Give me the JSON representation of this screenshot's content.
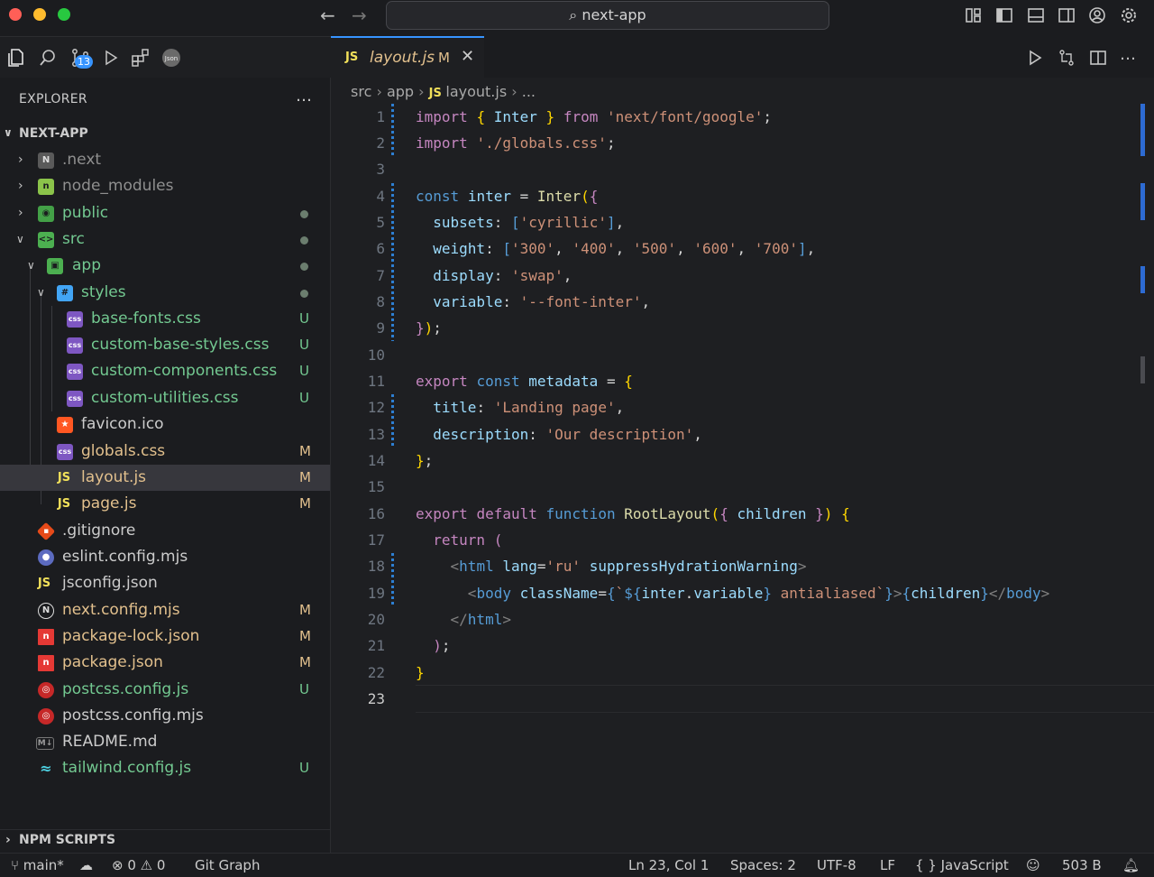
{
  "window": {
    "search_text": "next-app"
  },
  "activity": {
    "badge": "13"
  },
  "sidebar": {
    "title": "EXPLORER",
    "root": "NEXT-APP",
    "npm": "NPM SCRIPTS",
    "items": [
      {
        "name": ".next",
        "status": ""
      },
      {
        "name": "node_modules",
        "status": ""
      },
      {
        "name": "public",
        "status": ""
      },
      {
        "name": "src",
        "status": ""
      },
      {
        "name": "app",
        "status": ""
      },
      {
        "name": "styles",
        "status": ""
      },
      {
        "name": "base-fonts.css",
        "status": "U"
      },
      {
        "name": "custom-base-styles.css",
        "status": "U"
      },
      {
        "name": "custom-components.css",
        "status": "U"
      },
      {
        "name": "custom-utilities.css",
        "status": "U"
      },
      {
        "name": "favicon.ico",
        "status": ""
      },
      {
        "name": "globals.css",
        "status": "M"
      },
      {
        "name": "layout.js",
        "status": "M"
      },
      {
        "name": "page.js",
        "status": "M"
      },
      {
        "name": ".gitignore",
        "status": ""
      },
      {
        "name": "eslint.config.mjs",
        "status": ""
      },
      {
        "name": "jsconfig.json",
        "status": ""
      },
      {
        "name": "next.config.mjs",
        "status": "M"
      },
      {
        "name": "package-lock.json",
        "status": "M"
      },
      {
        "name": "package.json",
        "status": "M"
      },
      {
        "name": "postcss.config.js",
        "status": "U"
      },
      {
        "name": "postcss.config.mjs",
        "status": ""
      },
      {
        "name": "README.md",
        "status": ""
      },
      {
        "name": "tailwind.config.js",
        "status": "U"
      }
    ]
  },
  "editor": {
    "tab_label": "layout.js",
    "tab_status": "M",
    "tab_icon": "JS",
    "breadcrumb": [
      "src",
      "app",
      "layout.js",
      "..."
    ],
    "line_numbers": [
      "1",
      "2",
      "3",
      "4",
      "5",
      "6",
      "7",
      "8",
      "9",
      "10",
      "11",
      "12",
      "13",
      "14",
      "15",
      "16",
      "17",
      "18",
      "19",
      "20",
      "21",
      "22",
      "23"
    ]
  },
  "statusbar": {
    "branch": "main*",
    "errors": "0",
    "warnings": "0",
    "git_graph": "Git Graph",
    "position": "Ln 23, Col 1",
    "spaces": "Spaces: 2",
    "encoding": "UTF-8",
    "eol": "LF",
    "language": "JavaScript",
    "size": "503 B"
  },
  "colors": {
    "accent": "#3794ff",
    "untracked": "#73c991",
    "modified": "#e2c08d"
  }
}
